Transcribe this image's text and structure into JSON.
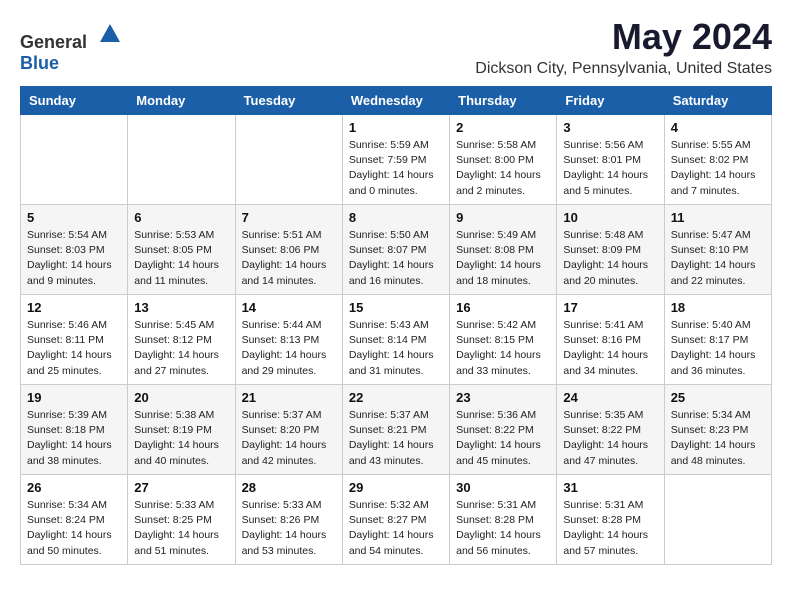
{
  "header": {
    "logo_general": "General",
    "logo_blue": "Blue",
    "title": "May 2024",
    "subtitle": "Dickson City, Pennsylvania, United States"
  },
  "weekdays": [
    "Sunday",
    "Monday",
    "Tuesday",
    "Wednesday",
    "Thursday",
    "Friday",
    "Saturday"
  ],
  "weeks": [
    [
      {
        "day": "",
        "info": ""
      },
      {
        "day": "",
        "info": ""
      },
      {
        "day": "",
        "info": ""
      },
      {
        "day": "1",
        "info": "Sunrise: 5:59 AM\nSunset: 7:59 PM\nDaylight: 14 hours\nand 0 minutes."
      },
      {
        "day": "2",
        "info": "Sunrise: 5:58 AM\nSunset: 8:00 PM\nDaylight: 14 hours\nand 2 minutes."
      },
      {
        "day": "3",
        "info": "Sunrise: 5:56 AM\nSunset: 8:01 PM\nDaylight: 14 hours\nand 5 minutes."
      },
      {
        "day": "4",
        "info": "Sunrise: 5:55 AM\nSunset: 8:02 PM\nDaylight: 14 hours\nand 7 minutes."
      }
    ],
    [
      {
        "day": "5",
        "info": "Sunrise: 5:54 AM\nSunset: 8:03 PM\nDaylight: 14 hours\nand 9 minutes."
      },
      {
        "day": "6",
        "info": "Sunrise: 5:53 AM\nSunset: 8:05 PM\nDaylight: 14 hours\nand 11 minutes."
      },
      {
        "day": "7",
        "info": "Sunrise: 5:51 AM\nSunset: 8:06 PM\nDaylight: 14 hours\nand 14 minutes."
      },
      {
        "day": "8",
        "info": "Sunrise: 5:50 AM\nSunset: 8:07 PM\nDaylight: 14 hours\nand 16 minutes."
      },
      {
        "day": "9",
        "info": "Sunrise: 5:49 AM\nSunset: 8:08 PM\nDaylight: 14 hours\nand 18 minutes."
      },
      {
        "day": "10",
        "info": "Sunrise: 5:48 AM\nSunset: 8:09 PM\nDaylight: 14 hours\nand 20 minutes."
      },
      {
        "day": "11",
        "info": "Sunrise: 5:47 AM\nSunset: 8:10 PM\nDaylight: 14 hours\nand 22 minutes."
      }
    ],
    [
      {
        "day": "12",
        "info": "Sunrise: 5:46 AM\nSunset: 8:11 PM\nDaylight: 14 hours\nand 25 minutes."
      },
      {
        "day": "13",
        "info": "Sunrise: 5:45 AM\nSunset: 8:12 PM\nDaylight: 14 hours\nand 27 minutes."
      },
      {
        "day": "14",
        "info": "Sunrise: 5:44 AM\nSunset: 8:13 PM\nDaylight: 14 hours\nand 29 minutes."
      },
      {
        "day": "15",
        "info": "Sunrise: 5:43 AM\nSunset: 8:14 PM\nDaylight: 14 hours\nand 31 minutes."
      },
      {
        "day": "16",
        "info": "Sunrise: 5:42 AM\nSunset: 8:15 PM\nDaylight: 14 hours\nand 33 minutes."
      },
      {
        "day": "17",
        "info": "Sunrise: 5:41 AM\nSunset: 8:16 PM\nDaylight: 14 hours\nand 34 minutes."
      },
      {
        "day": "18",
        "info": "Sunrise: 5:40 AM\nSunset: 8:17 PM\nDaylight: 14 hours\nand 36 minutes."
      }
    ],
    [
      {
        "day": "19",
        "info": "Sunrise: 5:39 AM\nSunset: 8:18 PM\nDaylight: 14 hours\nand 38 minutes."
      },
      {
        "day": "20",
        "info": "Sunrise: 5:38 AM\nSunset: 8:19 PM\nDaylight: 14 hours\nand 40 minutes."
      },
      {
        "day": "21",
        "info": "Sunrise: 5:37 AM\nSunset: 8:20 PM\nDaylight: 14 hours\nand 42 minutes."
      },
      {
        "day": "22",
        "info": "Sunrise: 5:37 AM\nSunset: 8:21 PM\nDaylight: 14 hours\nand 43 minutes."
      },
      {
        "day": "23",
        "info": "Sunrise: 5:36 AM\nSunset: 8:22 PM\nDaylight: 14 hours\nand 45 minutes."
      },
      {
        "day": "24",
        "info": "Sunrise: 5:35 AM\nSunset: 8:22 PM\nDaylight: 14 hours\nand 47 minutes."
      },
      {
        "day": "25",
        "info": "Sunrise: 5:34 AM\nSunset: 8:23 PM\nDaylight: 14 hours\nand 48 minutes."
      }
    ],
    [
      {
        "day": "26",
        "info": "Sunrise: 5:34 AM\nSunset: 8:24 PM\nDaylight: 14 hours\nand 50 minutes."
      },
      {
        "day": "27",
        "info": "Sunrise: 5:33 AM\nSunset: 8:25 PM\nDaylight: 14 hours\nand 51 minutes."
      },
      {
        "day": "28",
        "info": "Sunrise: 5:33 AM\nSunset: 8:26 PM\nDaylight: 14 hours\nand 53 minutes."
      },
      {
        "day": "29",
        "info": "Sunrise: 5:32 AM\nSunset: 8:27 PM\nDaylight: 14 hours\nand 54 minutes."
      },
      {
        "day": "30",
        "info": "Sunrise: 5:31 AM\nSunset: 8:28 PM\nDaylight: 14 hours\nand 56 minutes."
      },
      {
        "day": "31",
        "info": "Sunrise: 5:31 AM\nSunset: 8:28 PM\nDaylight: 14 hours\nand 57 minutes."
      },
      {
        "day": "",
        "info": ""
      }
    ]
  ]
}
